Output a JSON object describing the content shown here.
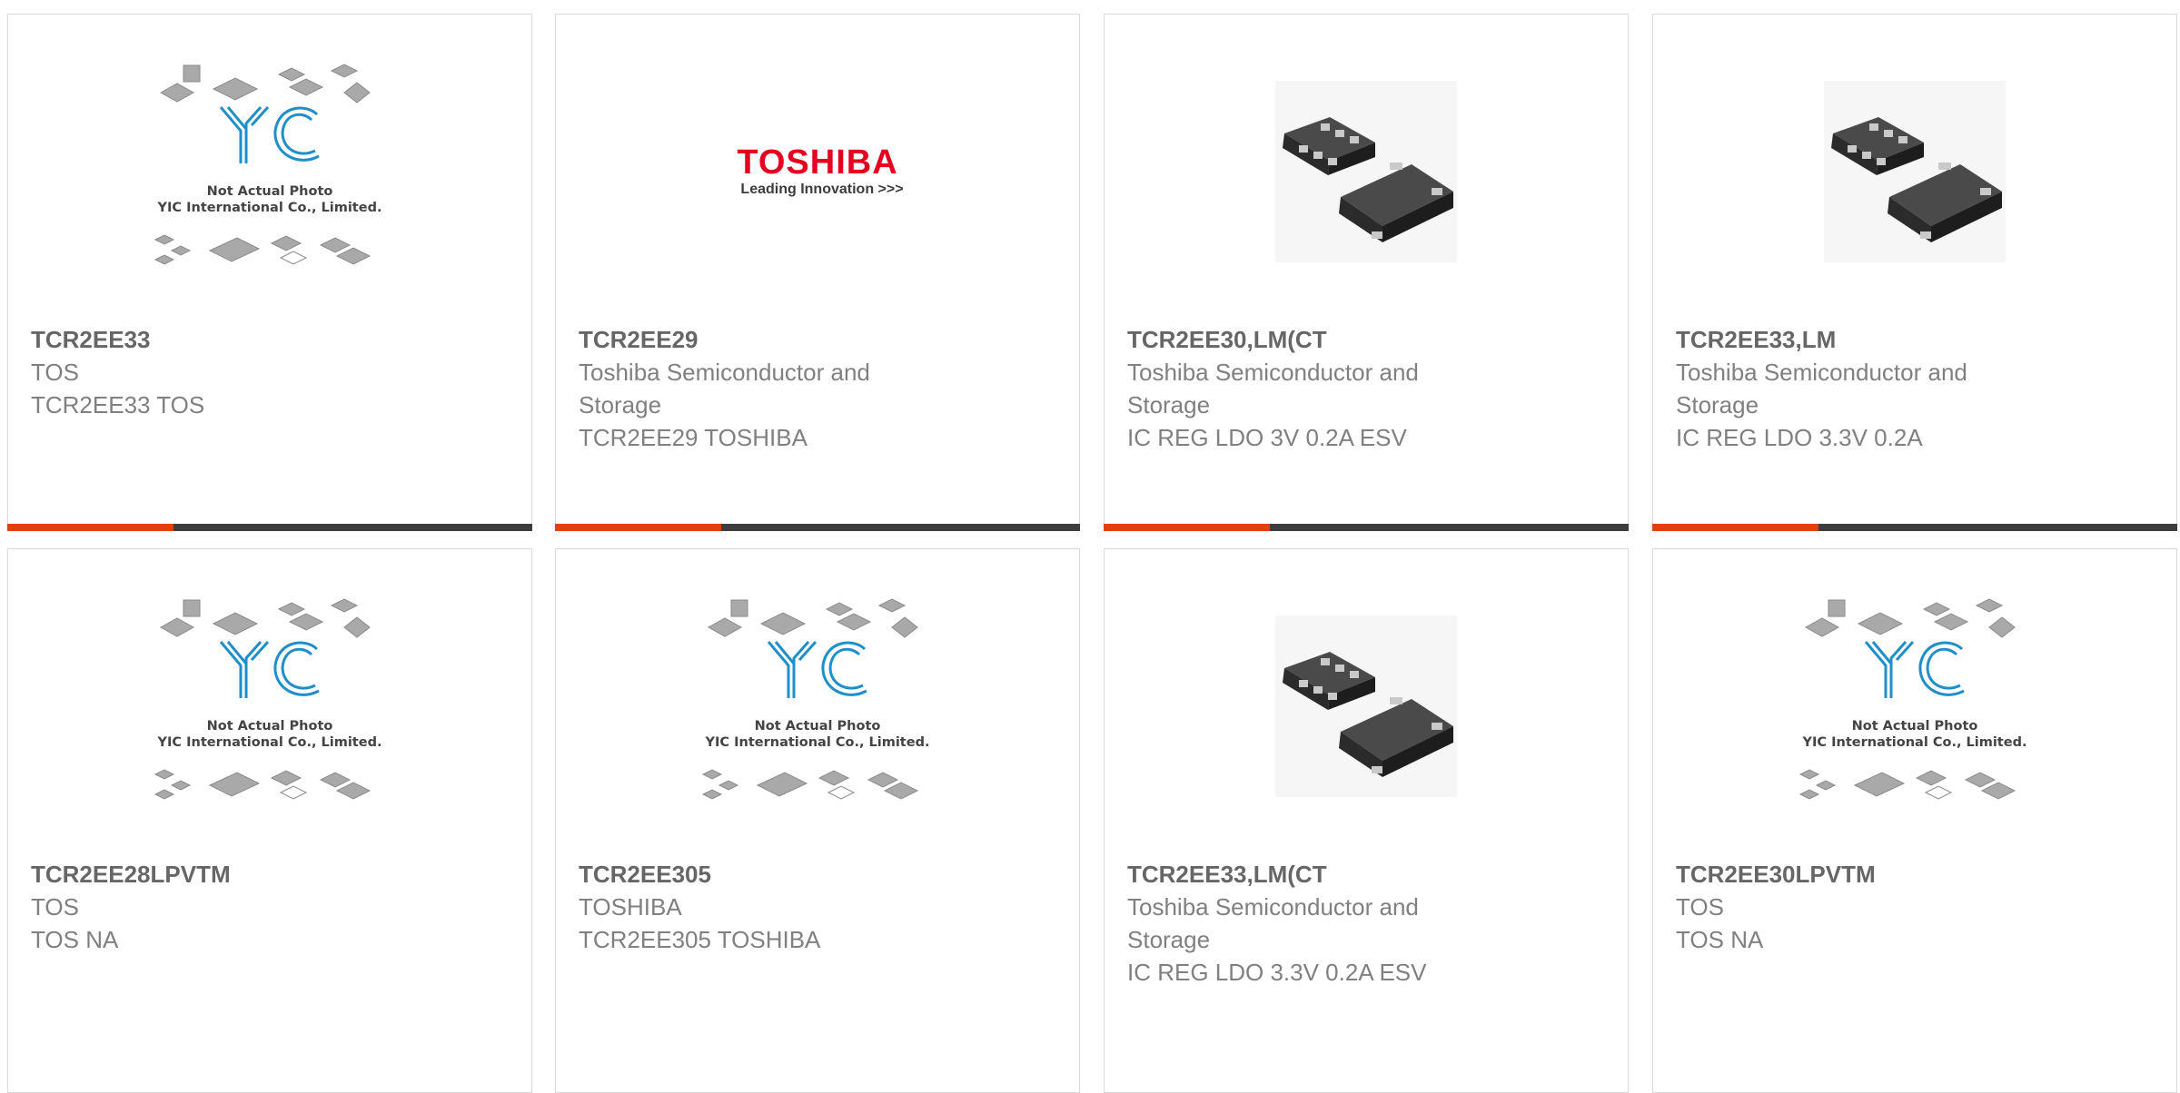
{
  "placeholder": {
    "line1": "Not Actual Photo",
    "line2": "YIC International Co., Limited."
  },
  "toshiba_logo": {
    "brand": "TOSHIBA",
    "tagline": "Leading Innovation >>>"
  },
  "colors": {
    "accent": "#e2410f",
    "bar": "#3d3d3d",
    "yic_blue": "#1f8fc9",
    "toshiba_red": "#e50020"
  },
  "products": [
    {
      "part": "TCR2EE33",
      "manufacturer": "TOS",
      "description": "TCR2EE33 TOS",
      "image": "placeholder"
    },
    {
      "part": "TCR2EE29",
      "manufacturer_line1": "Toshiba Semiconductor and",
      "manufacturer_line2": "Storage",
      "description": "TCR2EE29 TOSHIBA",
      "image": "toshiba-logo"
    },
    {
      "part": "TCR2EE30,LM(CT",
      "manufacturer_line1": "Toshiba Semiconductor and",
      "manufacturer_line2": "Storage",
      "description": "IC REG LDO 3V 0.2A ESV",
      "image": "chip-photo"
    },
    {
      "part": "TCR2EE33,LM",
      "manufacturer_line1": "Toshiba Semiconductor and",
      "manufacturer_line2": "Storage",
      "description": "IC REG LDO 3.3V 0.2A",
      "image": "chip-photo"
    },
    {
      "part": "TCR2EE28LPVTM",
      "manufacturer": "TOS",
      "description": "TOS NA",
      "image": "placeholder"
    },
    {
      "part": "TCR2EE305",
      "manufacturer": "TOSHIBA",
      "description": "TCR2EE305 TOSHIBA",
      "image": "placeholder"
    },
    {
      "part": "TCR2EE33,LM(CT",
      "manufacturer_line1": "Toshiba Semiconductor and",
      "manufacturer_line2": "Storage",
      "description": "IC REG LDO 3.3V 0.2A ESV",
      "image": "chip-photo"
    },
    {
      "part": "TCR2EE30LPVTM",
      "manufacturer": "TOS",
      "description": "TOS NA",
      "image": "placeholder"
    }
  ]
}
